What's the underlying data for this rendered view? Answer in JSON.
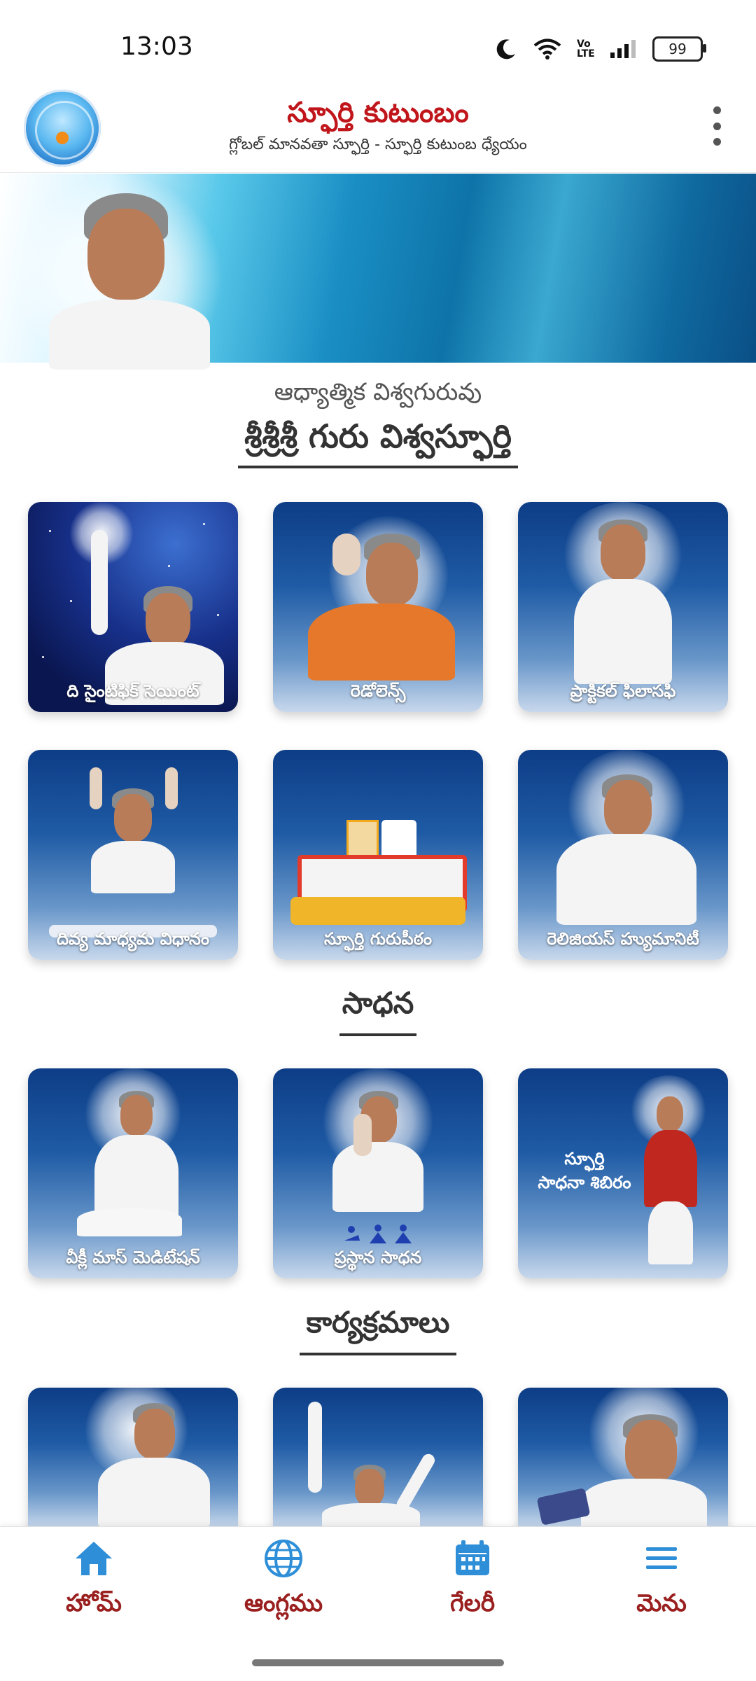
{
  "status_bar": {
    "time": "13:03",
    "battery": "99",
    "network_label": "Vo LTE"
  },
  "header": {
    "title": "స్ఫూర్తి కుటుంబం",
    "subtitle": "గ్లోబల్ మానవతా స్ఫూర్తి - స్ఫూర్తి కుటుంబ ధ్యేయం",
    "menu_icon": "more-vertical-icon"
  },
  "intro": {
    "subheading": "ఆధ్యాత్మిక విశ్వగురువు",
    "heading": "శ్రీశ్రీశ్రీ గురు విశ్వస్ఫూర్తి"
  },
  "grid_top": [
    {
      "label": "ది సైంటిఫిక్ సెయింట్"
    },
    {
      "label": "రెడోలెన్స్"
    },
    {
      "label": "ప్రాక్టికల్ ఫిలాసఫి"
    },
    {
      "label": "దివ్య మాధ్యమ విధానం"
    },
    {
      "label": "స్ఫూర్తి గురుపీఠం"
    },
    {
      "label": "రెలిజియస్ హ్యుమానిటీ"
    }
  ],
  "sadhana": {
    "heading": "సాధన",
    "cards": [
      {
        "label": "వీక్లీ మాస్ మెడిటేషన్"
      },
      {
        "label": "ప్రస్థాన సాధన"
      },
      {
        "label_line1": "స్ఫూర్తి",
        "label_line2": "సాధనా శిబిరం"
      }
    ]
  },
  "programs": {
    "heading": "కార్యక్రమాలు"
  },
  "bottom_nav": [
    {
      "label": "హోమ్",
      "icon": "home-icon",
      "color": "#2e8fd8"
    },
    {
      "label": "ఆంగ్లము",
      "icon": "globe-icon",
      "color": "#2e8fd8"
    },
    {
      "label": "గేలరీ",
      "icon": "calendar-icon",
      "color": "#2e8fd8"
    },
    {
      "label": "మెను",
      "icon": "menu-icon",
      "color": "#2e8fd8"
    }
  ],
  "colors": {
    "title_red": "#c0161b",
    "nav_label": "#9a1f1f",
    "card_blue": "#0d3d86",
    "icon_blue": "#2e8fd8"
  }
}
